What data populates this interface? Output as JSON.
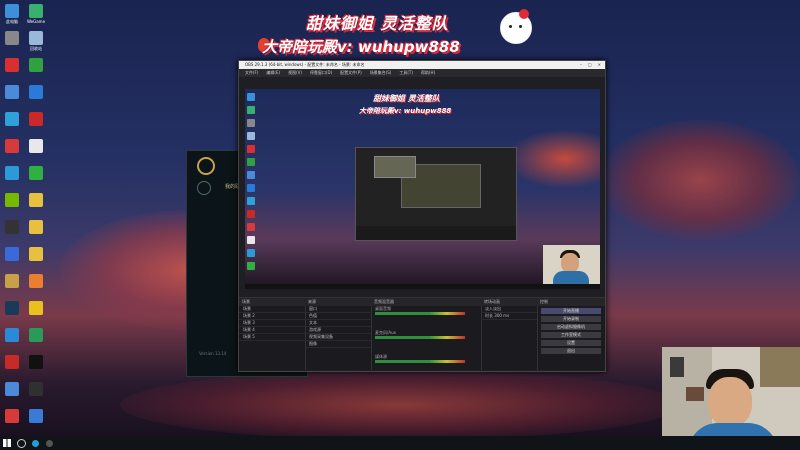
{
  "banner": {
    "line1": "甜妹御姐 灵活整队",
    "line2": "大帝陪玩殿v: wuhupw888",
    "accent": "#e02a3a"
  },
  "desktop": {
    "icons": [
      {
        "name": "computer-icon",
        "label": "此电脑",
        "color": "#3d8fd8"
      },
      {
        "name": "wegame-icon",
        "label": "WeGame",
        "color": "#3ab070"
      },
      {
        "name": "gear-app-icon",
        "label": "",
        "color": "#888888"
      },
      {
        "name": "recycle-bin-icon",
        "label": "回收站",
        "color": "#9ab8d8"
      },
      {
        "name": "game-red-icon",
        "label": "",
        "color": "#d83030"
      },
      {
        "name": "green-app-icon",
        "label": "",
        "color": "#30a040"
      },
      {
        "name": "control-panel-icon",
        "label": "",
        "color": "#4a8ad8"
      },
      {
        "name": "store-icon",
        "label": "",
        "color": "#2a7ad8"
      },
      {
        "name": "browser-icon",
        "label": "",
        "color": "#30a0d8"
      },
      {
        "name": "netease-icon",
        "label": "",
        "color": "#c82a2a"
      },
      {
        "name": "music-icon",
        "label": "",
        "color": "#d83a3a"
      },
      {
        "name": "document-icon",
        "label": "",
        "color": "#e8e8e8"
      },
      {
        "name": "edge-icon",
        "label": "",
        "color": "#2a9ad8"
      },
      {
        "name": "wechat-icon",
        "label": "",
        "color": "#30b040"
      },
      {
        "name": "nvidia-icon",
        "label": "",
        "color": "#76b900"
      },
      {
        "name": "folder-icon",
        "label": "",
        "color": "#e8c040"
      },
      {
        "name": "obs-icon",
        "label": "",
        "color": "#333333"
      },
      {
        "name": "folder2-icon",
        "label": "",
        "color": "#e8c040"
      },
      {
        "name": "app-blue-icon",
        "label": "",
        "color": "#3a6ad8"
      },
      {
        "name": "folder3-icon",
        "label": "",
        "color": "#e8c040"
      },
      {
        "name": "lol-icon",
        "label": "",
        "color": "#c8a04a"
      },
      {
        "name": "orange-app-icon",
        "label": "",
        "color": "#e88030"
      },
      {
        "name": "steam-icon",
        "label": "",
        "color": "#1a3a5a"
      },
      {
        "name": "yellow-circle-icon",
        "label": "",
        "color": "#e8c020"
      },
      {
        "name": "todo-icon",
        "label": "",
        "color": "#2a8ad8"
      },
      {
        "name": "app-green-icon",
        "label": "",
        "color": "#2a9a5a"
      },
      {
        "name": "game2-icon",
        "label": "",
        "color": "#c82a2a"
      },
      {
        "name": "tiktok-icon",
        "label": "",
        "color": "#111111"
      },
      {
        "name": "chrome-icon",
        "label": "",
        "color": "#4a8ad8"
      },
      {
        "name": "app-dark-icon",
        "label": "",
        "color": "#303030"
      },
      {
        "name": "wps-icon",
        "label": "",
        "color": "#d83a3a"
      },
      {
        "name": "app-last-icon",
        "label": "",
        "color": "#3a7ad8"
      }
    ]
  },
  "lol_client": {
    "label": "我的联盟",
    "status": "Version 13.14"
  },
  "obs": {
    "title": "OBS 29.1.3 (64-bit, windows) - 配置文件: 未命名 - 场景: 未命名",
    "menu": [
      "文件(F)",
      "编辑(E)",
      "视图(V)",
      "停靠窗口(D)",
      "配置文件(P)",
      "场景集合(S)",
      "工具(T)",
      "帮助(H)"
    ],
    "docks": {
      "scenes": {
        "header": "场景",
        "items": [
          "场景",
          "场景 2",
          "场景 3",
          "场景 4",
          "场景 5"
        ]
      },
      "sources": {
        "header": "来源",
        "items": [
          "窗口",
          "色值",
          "文本",
          "游戏源",
          "视频采集设备",
          "图像"
        ]
      },
      "mixer": {
        "header": "音频混音器",
        "channels": [
          "桌面音频",
          "麦克风/Aux",
          "媒体源"
        ]
      },
      "transitions": {
        "header": "转场动画",
        "items": [
          "淡入淡出",
          "时长 300 ms"
        ]
      },
      "controls": {
        "header": "控制",
        "items": [
          "开始直播",
          "开始录制",
          "启动虚拟摄像机",
          "工作室模式",
          "设置",
          "退出"
        ]
      }
    }
  }
}
